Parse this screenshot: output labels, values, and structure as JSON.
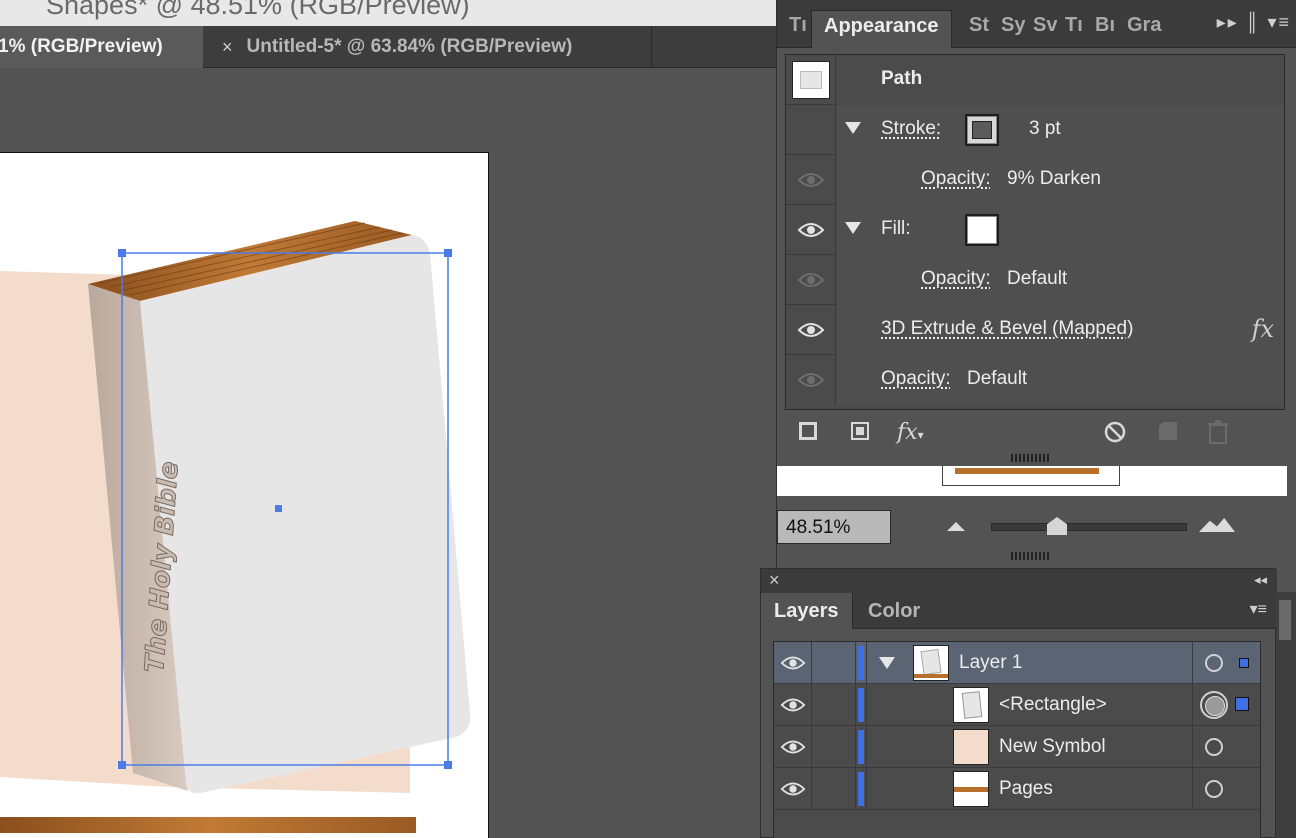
{
  "window": {
    "title": "Shapes* @ 48.51% (RGB/Preview)"
  },
  "doc_tabs": [
    {
      "label": "1% (RGB/Preview)"
    },
    {
      "close": "×",
      "label": "Untitled-5* @ 63.84% (RGB/Preview)"
    }
  ],
  "artwork": {
    "spine_text": "The Holy Bible",
    "selection_color": "#3f6fe0",
    "wood_color": "#b86f2c",
    "pages_color": "#f4dccd"
  },
  "appearance": {
    "tabs": [
      "Tı",
      "Appearance",
      "St",
      "Sy",
      "Sv",
      "Tı",
      "Bı",
      "Gra"
    ],
    "active_tab": "Appearance",
    "menu_icons": "▸▸ ║ ▾≡",
    "header": "Path",
    "stroke": {
      "label": "Stroke:",
      "value": "3 pt"
    },
    "stroke_opacity": {
      "label": "Opacity:",
      "value": "9% Darken"
    },
    "fill": {
      "label": "Fill:"
    },
    "fill_opacity": {
      "label": "Opacity:",
      "value": "Default"
    },
    "effect": {
      "label": "3D Extrude & Bevel (Mapped)",
      "fx": "fx"
    },
    "opacity": {
      "label": "Opacity:",
      "value": "Default"
    },
    "footer_icons": [
      "new-stroke-icon",
      "new-fill-icon",
      "add-effect-icon",
      "clear-appearance-icon",
      "duplicate-item-icon",
      "delete-item-icon"
    ],
    "footer_fx": "fx"
  },
  "navigator": {
    "zoom": "48.51%"
  },
  "layers": {
    "tabs": [
      "Layers",
      "Color"
    ],
    "active_tab": "Layers",
    "close": "×",
    "collapse": "◂◂",
    "menu": "▾≡",
    "rows": [
      {
        "name": "Layer 1"
      },
      {
        "name": "<Rectangle>"
      },
      {
        "name": "New Symbol"
      },
      {
        "name": "Pages"
      }
    ]
  }
}
